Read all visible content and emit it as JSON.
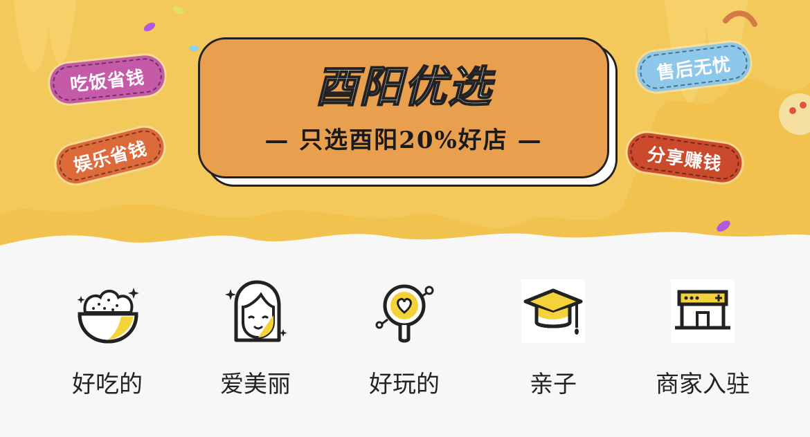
{
  "banner": {
    "title": "酉阳优选",
    "subtitle": "— 只选酉阳20%好店 —",
    "tags": {
      "eat": "吃饭省钱",
      "fun": "娱乐省钱",
      "after_sale": "售后无忧",
      "share": "分享赚钱"
    },
    "colors": {
      "background": "#f1c24e",
      "card": "#e9a04e"
    }
  },
  "categories": [
    {
      "label": "好吃的",
      "icon": "rice-bowl-icon"
    },
    {
      "label": "爱美丽",
      "icon": "beauty-girl-icon"
    },
    {
      "label": "好玩的",
      "icon": "magnifier-heart-icon"
    },
    {
      "label": "亲子",
      "icon": "graduation-cap-icon"
    },
    {
      "label": "商家入驻",
      "icon": "storefront-icon"
    }
  ]
}
